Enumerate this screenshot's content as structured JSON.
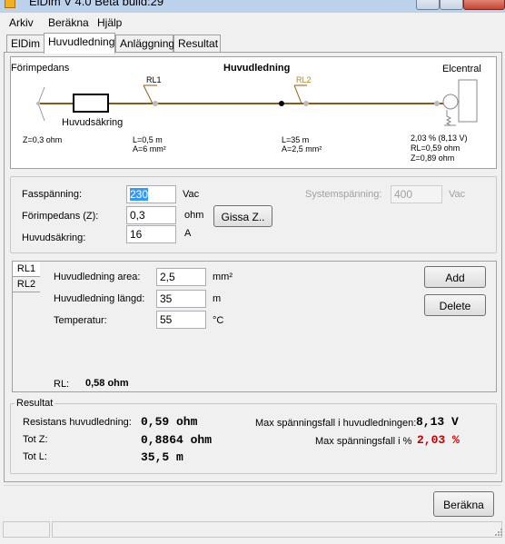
{
  "window": {
    "title": "ElDim V 4.0 Beta build:29"
  },
  "menu": {
    "items": [
      "Arkiv",
      "Beräkna",
      "Hjälp"
    ]
  },
  "tabs": [
    "ElDim",
    "Huvudledning",
    "Anläggning",
    "Resultat"
  ],
  "diagram": {
    "title": "Huvudledning",
    "forimpedans": "Förimpedans",
    "elcentral": "Elcentral",
    "huvudsakring": "Huvudsäkring",
    "z_label": "Z=0,3 ohm",
    "rl1": "RL1",
    "rl2": "RL2",
    "rl1_length": "L=0,5 m",
    "rl1_area": "A=6 mm²",
    "rl2_length": "L=35 m",
    "rl2_area": "A=2,5 mm²",
    "end_drop": "2,03 % (8,13 V)",
    "end_rl": "RL=0,59 ohm",
    "end_z": "Z=0,89 ohm"
  },
  "settings": {
    "fasspanning_label": "Fasspänning:",
    "fasspanning_value": "230",
    "fasspanning_unit": "Vac",
    "forimpedans_label": "Förimpedans (Z):",
    "forimpedans_value": "0,3",
    "forimpedans_unit": "ohm",
    "gissa_button": "Gissa Z..",
    "huvudsakring_label": "Huvudsäkring:",
    "huvudsakring_value": "16",
    "huvudsakring_unit": "A",
    "systemspanning_label": "Systemspänning:",
    "systemspanning_value": "400",
    "systemspanning_unit": "Vac"
  },
  "segments": {
    "tabs": [
      "RL1",
      "RL2"
    ],
    "area_label": "Huvudledning area:",
    "area_value": "2,5",
    "area_unit": "mm²",
    "length_label": "Huvudledning längd:",
    "length_value": "35",
    "length_unit": "m",
    "temp_label": "Temperatur:",
    "temp_value": "55",
    "temp_unit": "°C",
    "add_button": "Add",
    "delete_button": "Delete",
    "rl_label": "RL:",
    "rl_value": "0,58 ohm"
  },
  "results": {
    "group_label": "Resultat",
    "resistans_label": "Resistans huvudledning:",
    "resistans_value": "0,59 ohm",
    "totz_label": "Tot Z:",
    "totz_value": "0,8864 ohm",
    "totl_label": "Tot L:",
    "totl_value": "35,5 m",
    "maxfall_v_label": "Max spänningsfall i huvudledningen:",
    "maxfall_v_value": "8,13 V",
    "maxfall_pct_label": "Max spänningsfall i %",
    "maxfall_pct_value": "2,03 %"
  },
  "footer": {
    "berakna_button": "Beräkna"
  },
  "colors": {
    "accent_red": "#c00000",
    "selection": "#3399ff",
    "rl2_orange": "#c88000",
    "line_brown": "#8b5a14"
  }
}
